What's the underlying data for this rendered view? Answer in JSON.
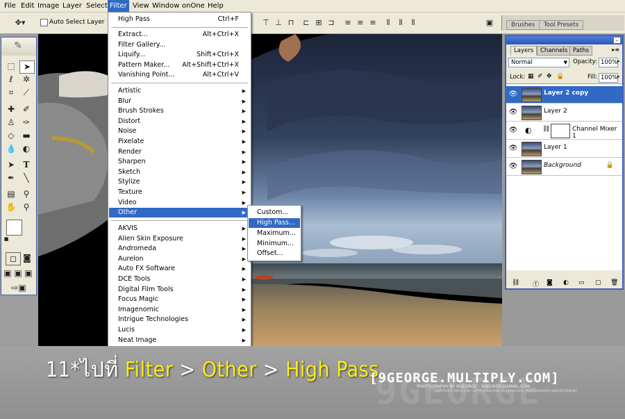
{
  "menubar": {
    "items": [
      "File",
      "Edit",
      "Image",
      "Layer",
      "Select",
      "Filter",
      "View",
      "Window",
      "onOne",
      "Help"
    ],
    "active": "Filter"
  },
  "options": {
    "auto_select_label": "Auto Select Layer"
  },
  "palette_well": {
    "tabs": [
      "Brushes",
      "Tool Presets"
    ]
  },
  "filter_menu": {
    "last": {
      "label": "High Pass",
      "shortcut": "Ctrl+F"
    },
    "group2": [
      {
        "label": "Extract...",
        "shortcut": "Alt+Ctrl+X"
      },
      {
        "label": "Filter Gallery...",
        "shortcut": ""
      },
      {
        "label": "Liquify...",
        "shortcut": "Shift+Ctrl+X"
      },
      {
        "label": "Pattern Maker...",
        "shortcut": "Alt+Shift+Ctrl+X"
      },
      {
        "label": "Vanishing Point...",
        "shortcut": "Alt+Ctrl+V"
      }
    ],
    "group3": [
      "Artistic",
      "Blur",
      "Brush Strokes",
      "Distort",
      "Noise",
      "Pixelate",
      "Render",
      "Sharpen",
      "Sketch",
      "Stylize",
      "Texture",
      "Video",
      "Other"
    ],
    "group4": [
      "AKVIS",
      "Alien Skin Exposure",
      "Andromeda",
      "Aurelon",
      "Auto FX Software",
      "DCE Tools",
      "Digital Film Tools",
      "Focus Magic",
      "Imagenomic",
      "Intrigue Technologies",
      "Lucis",
      "Neat Image"
    ],
    "highlighted": "Other"
  },
  "other_submenu": {
    "items": [
      "Custom...",
      "High Pass...",
      "Maximum...",
      "Minimum...",
      "Offset..."
    ],
    "highlighted": "High Pass..."
  },
  "layers_panel": {
    "tabs": [
      "Layers",
      "Channels",
      "Paths"
    ],
    "blend_mode": "Normal",
    "opacity_label": "Opacity:",
    "opacity": "100%",
    "lock_label": "Lock:",
    "fill_label": "Fill:",
    "fill": "100%",
    "layers": [
      {
        "name": "Layer 2 copy",
        "selected": true
      },
      {
        "name": "Layer 2",
        "selected": false
      },
      {
        "name": "Channel Mixer 1",
        "selected": false
      },
      {
        "name": "Layer 1",
        "selected": false
      },
      {
        "name": "Background",
        "selected": false
      }
    ]
  },
  "caption": {
    "prefix": "11*ไปที่ ",
    "filter": "Filter",
    "sep1": " > ",
    "other": "Other",
    "sep2": " > ",
    "highpass": "High Pass"
  },
  "brand": {
    "title": "[9GEORGE.MULTIPLY.COM]",
    "sub": "PHOTOGRAPHY BY 9GEORGE : 9GEORGE@GMAIL.COM",
    "sub2": "COPYRIGHT NOTICE BY : HTTP://9GEORGE.MULTIPLY.COM | PHOTOGRAPHS ADVERTISEMENT",
    "watermark": "9GEORGE"
  },
  "colors": {
    "accent": "#316ac5",
    "caption_highlight": "#ffee10",
    "chrome": "#ece9d8"
  }
}
